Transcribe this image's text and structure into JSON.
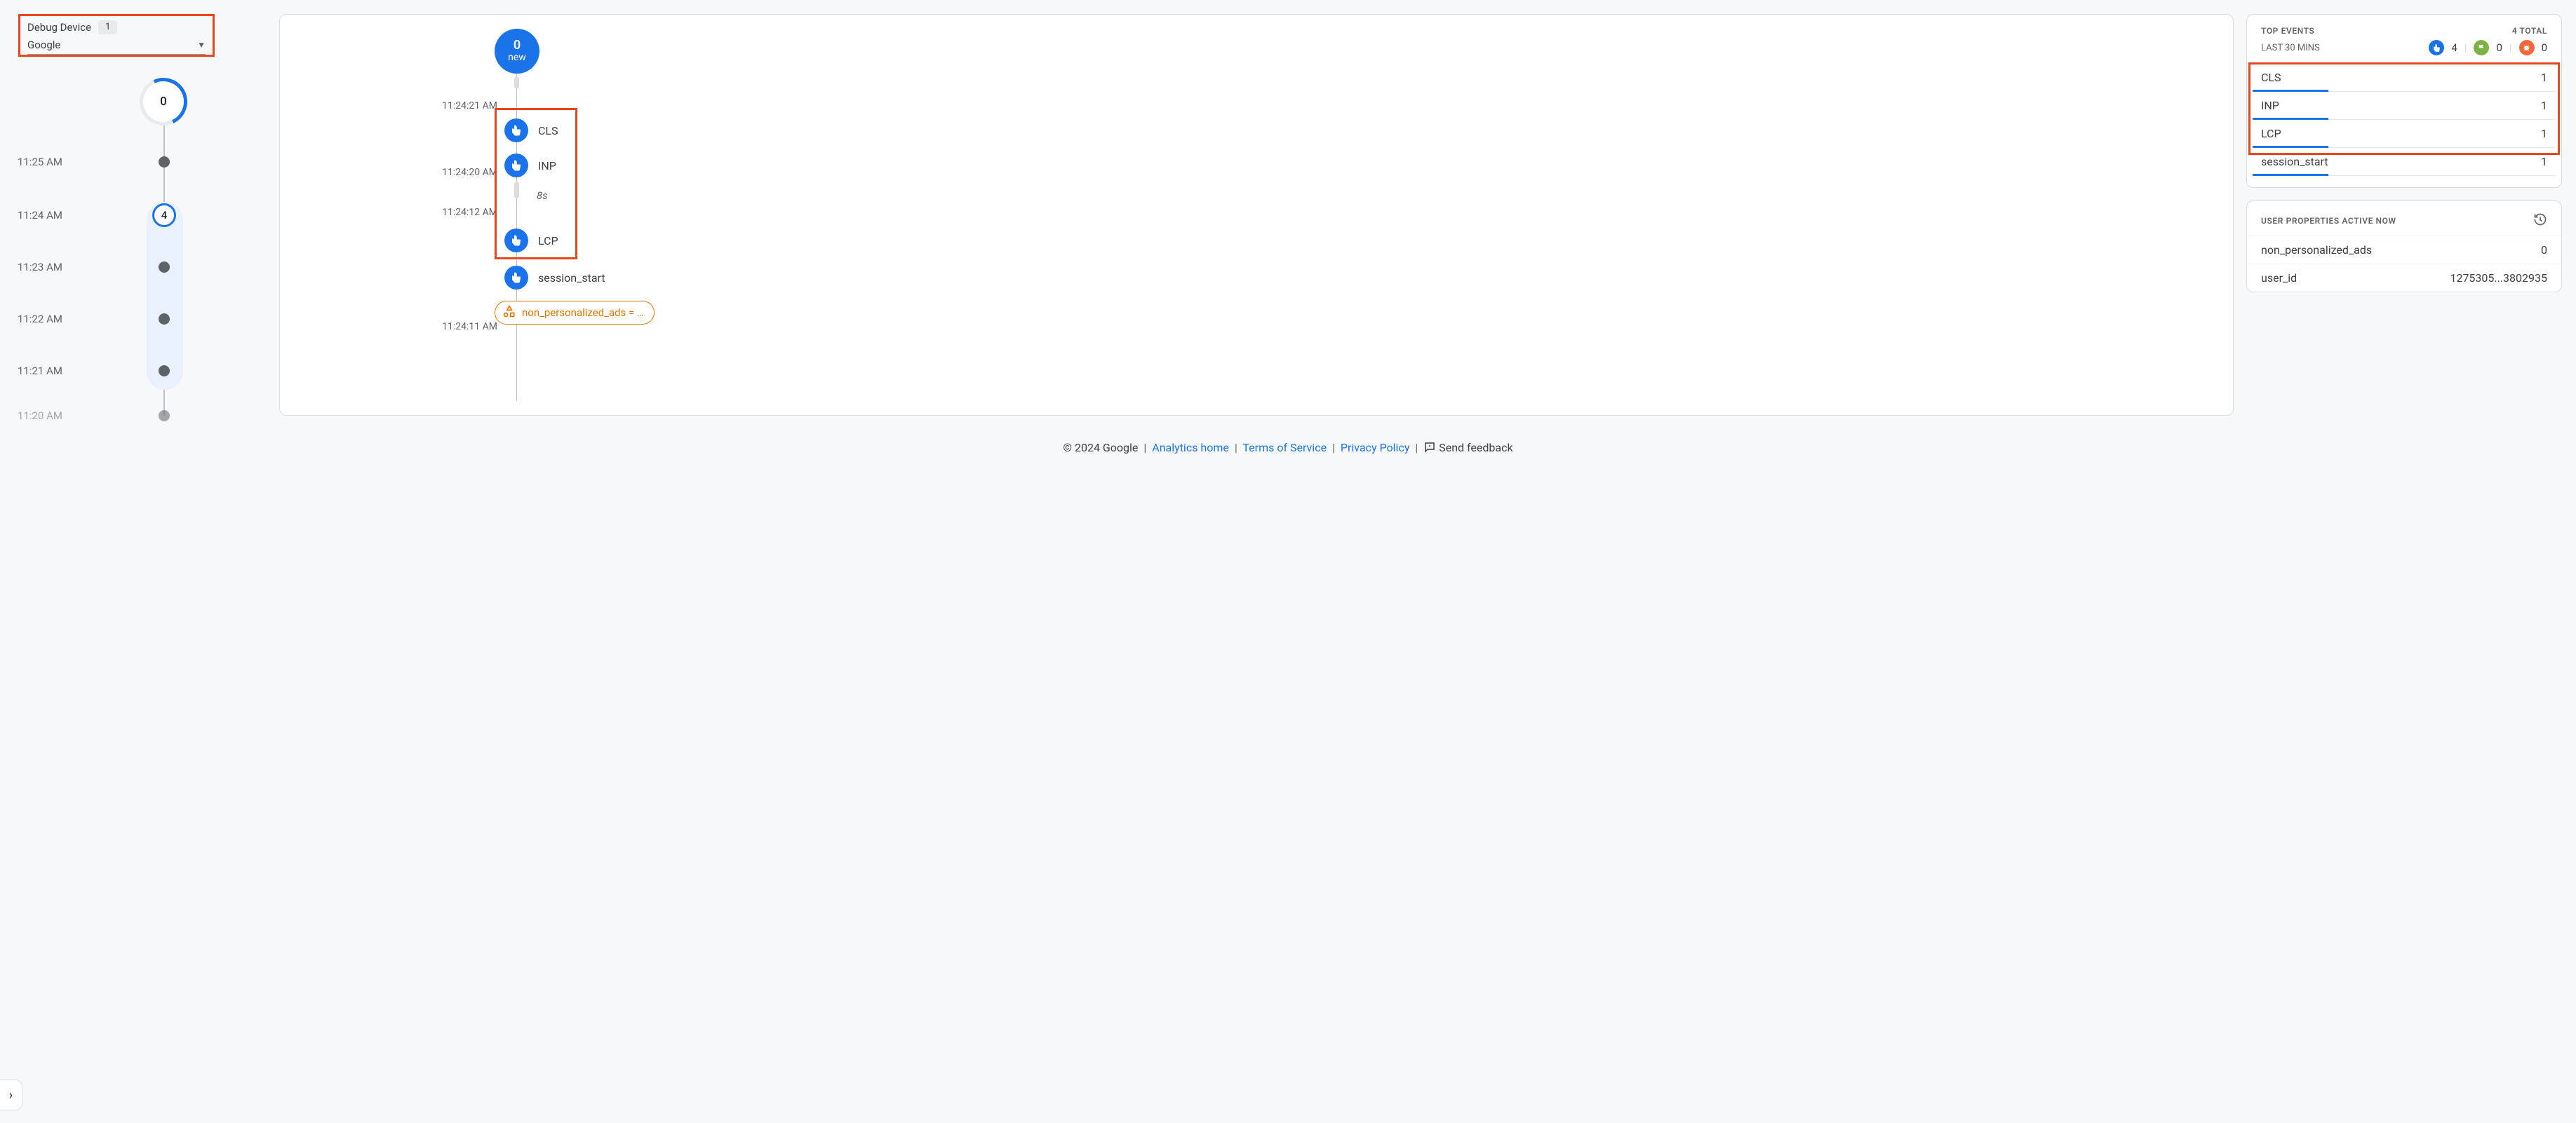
{
  "debug": {
    "title": "Debug Device",
    "count": "1",
    "selected": "Google"
  },
  "miniTimeline": {
    "topCount": "0",
    "selectedCount": "4",
    "labels": [
      "11:25 AM",
      "11:24 AM",
      "11:23 AM",
      "11:22 AM",
      "11:21 AM",
      "11:20 AM"
    ]
  },
  "center": {
    "bubbleNum": "0",
    "bubbleSub": "new",
    "times": {
      "t1": "11:24:21 AM",
      "t2": "11:24:20 AM",
      "t3": "11:24:12 AM",
      "t4": "11:24:11 AM"
    },
    "gapLabel": "8s",
    "events": {
      "e1": "CLS",
      "e2": "INP",
      "e3": "LCP",
      "e4": "session_start"
    },
    "propPill": "non_personalized_ads = …"
  },
  "topEvents": {
    "header": "TOP EVENTS",
    "totalLabel": "4 TOTAL",
    "sub": "LAST 30 MINS",
    "counters": {
      "touch": "4",
      "flag": "0",
      "bug": "0"
    },
    "rows": [
      {
        "name": "CLS",
        "count": "1",
        "bar": 25
      },
      {
        "name": "INP",
        "count": "1",
        "bar": 25
      },
      {
        "name": "LCP",
        "count": "1",
        "bar": 25
      },
      {
        "name": "session_start",
        "count": "1",
        "bar": 25
      }
    ]
  },
  "userProps": {
    "header": "USER PROPERTIES ACTIVE NOW",
    "rows": [
      {
        "name": "non_personalized_ads",
        "value": "0"
      },
      {
        "name": "user_id",
        "value": "1275305...3802935"
      }
    ]
  },
  "footer": {
    "copyright": "© 2024 Google",
    "links": {
      "home": "Analytics home",
      "tos": "Terms of Service",
      "privacy": "Privacy Policy"
    },
    "feedback": "Send feedback"
  }
}
